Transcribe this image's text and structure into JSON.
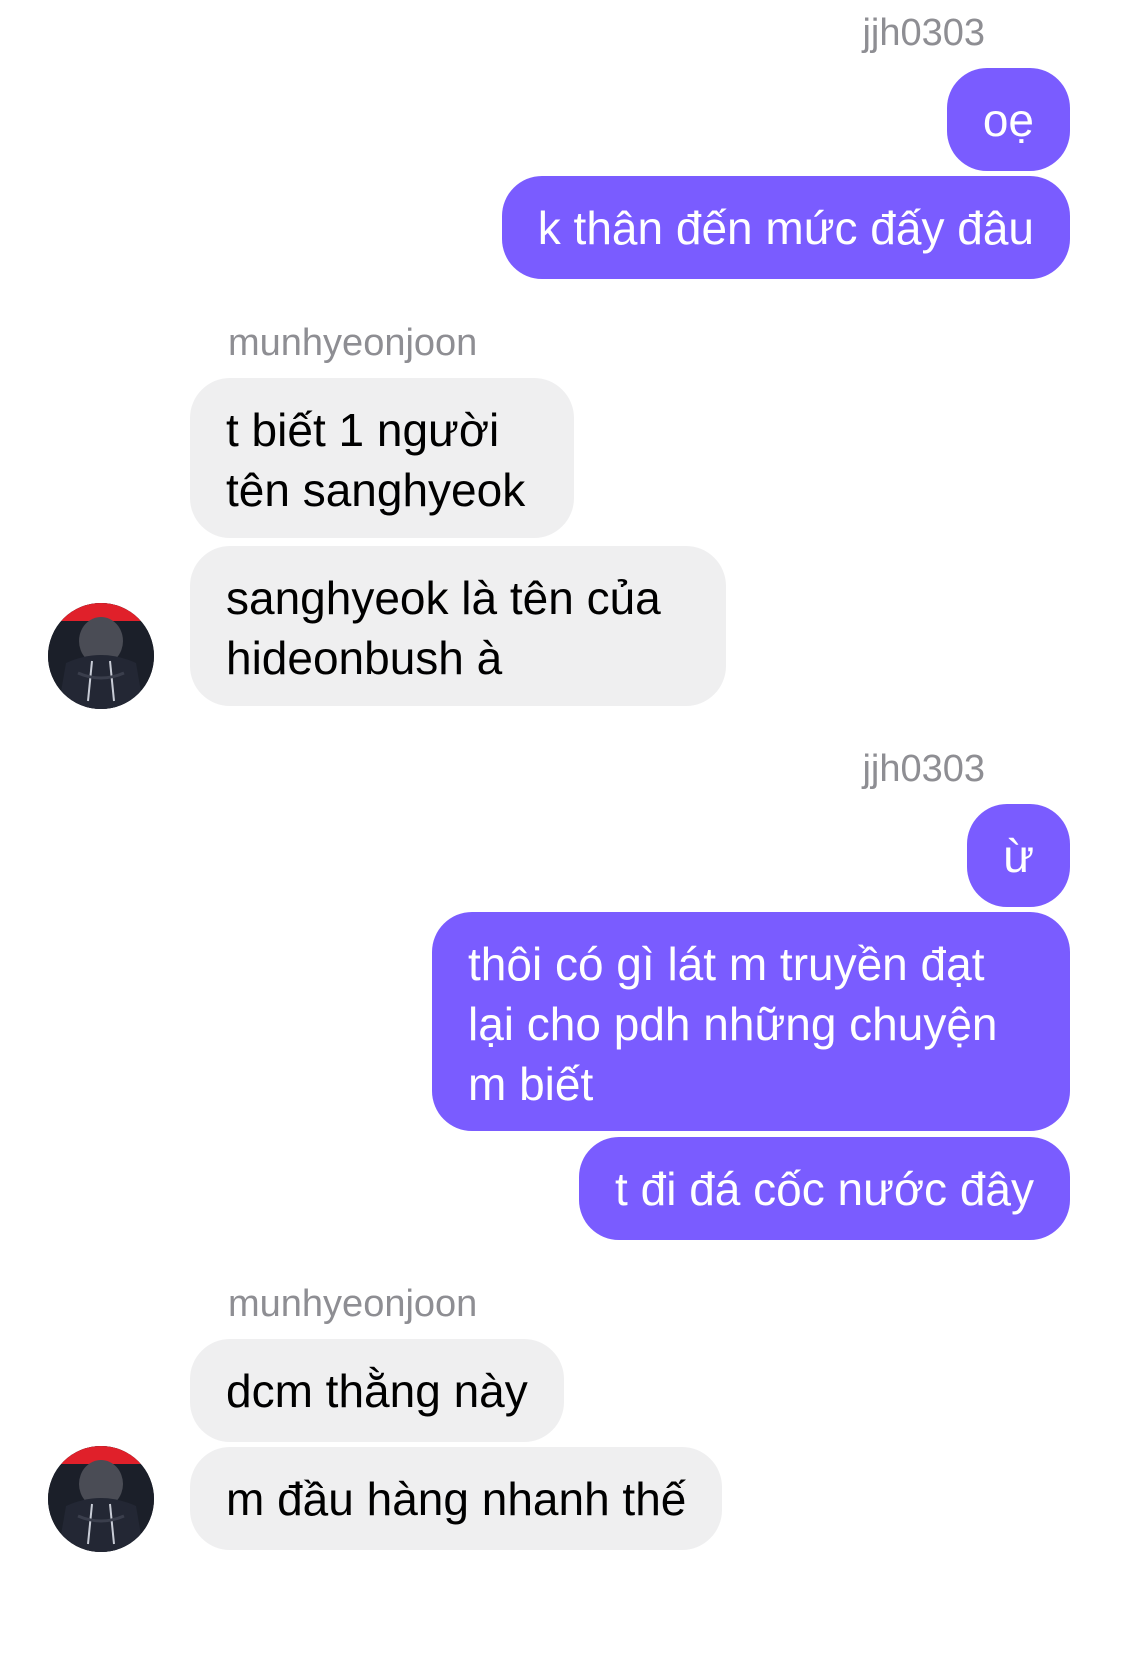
{
  "colors": {
    "outgoing_bubble": "#7a5cff",
    "incoming_bubble": "#efeff0",
    "sender_name": "#8e8e93",
    "background": "#ffffff"
  },
  "groups": [
    {
      "direction": "outgoing",
      "sender": "jjh0303",
      "messages": [
        "oẹ",
        "k thân đến mức đấy đâu"
      ]
    },
    {
      "direction": "incoming",
      "sender": "munhyeonjoon",
      "avatar_icon": "user-avatar-icon",
      "messages": [
        "t biết 1 người\ntên sanghyeok",
        "sanghyeok là tên của\nhideonbush à"
      ]
    },
    {
      "direction": "outgoing",
      "sender": "jjh0303",
      "messages": [
        "ừ",
        "thôi có gì lát m truyền đạt\nlại cho pdh những chuyện\nm biết",
        "t đi đá cốc nước đây"
      ]
    },
    {
      "direction": "incoming",
      "sender": "munhyeonjoon",
      "avatar_icon": "user-avatar-icon",
      "messages": [
        "dcm thằng này",
        "m đầu hàng nhanh thế"
      ]
    }
  ]
}
